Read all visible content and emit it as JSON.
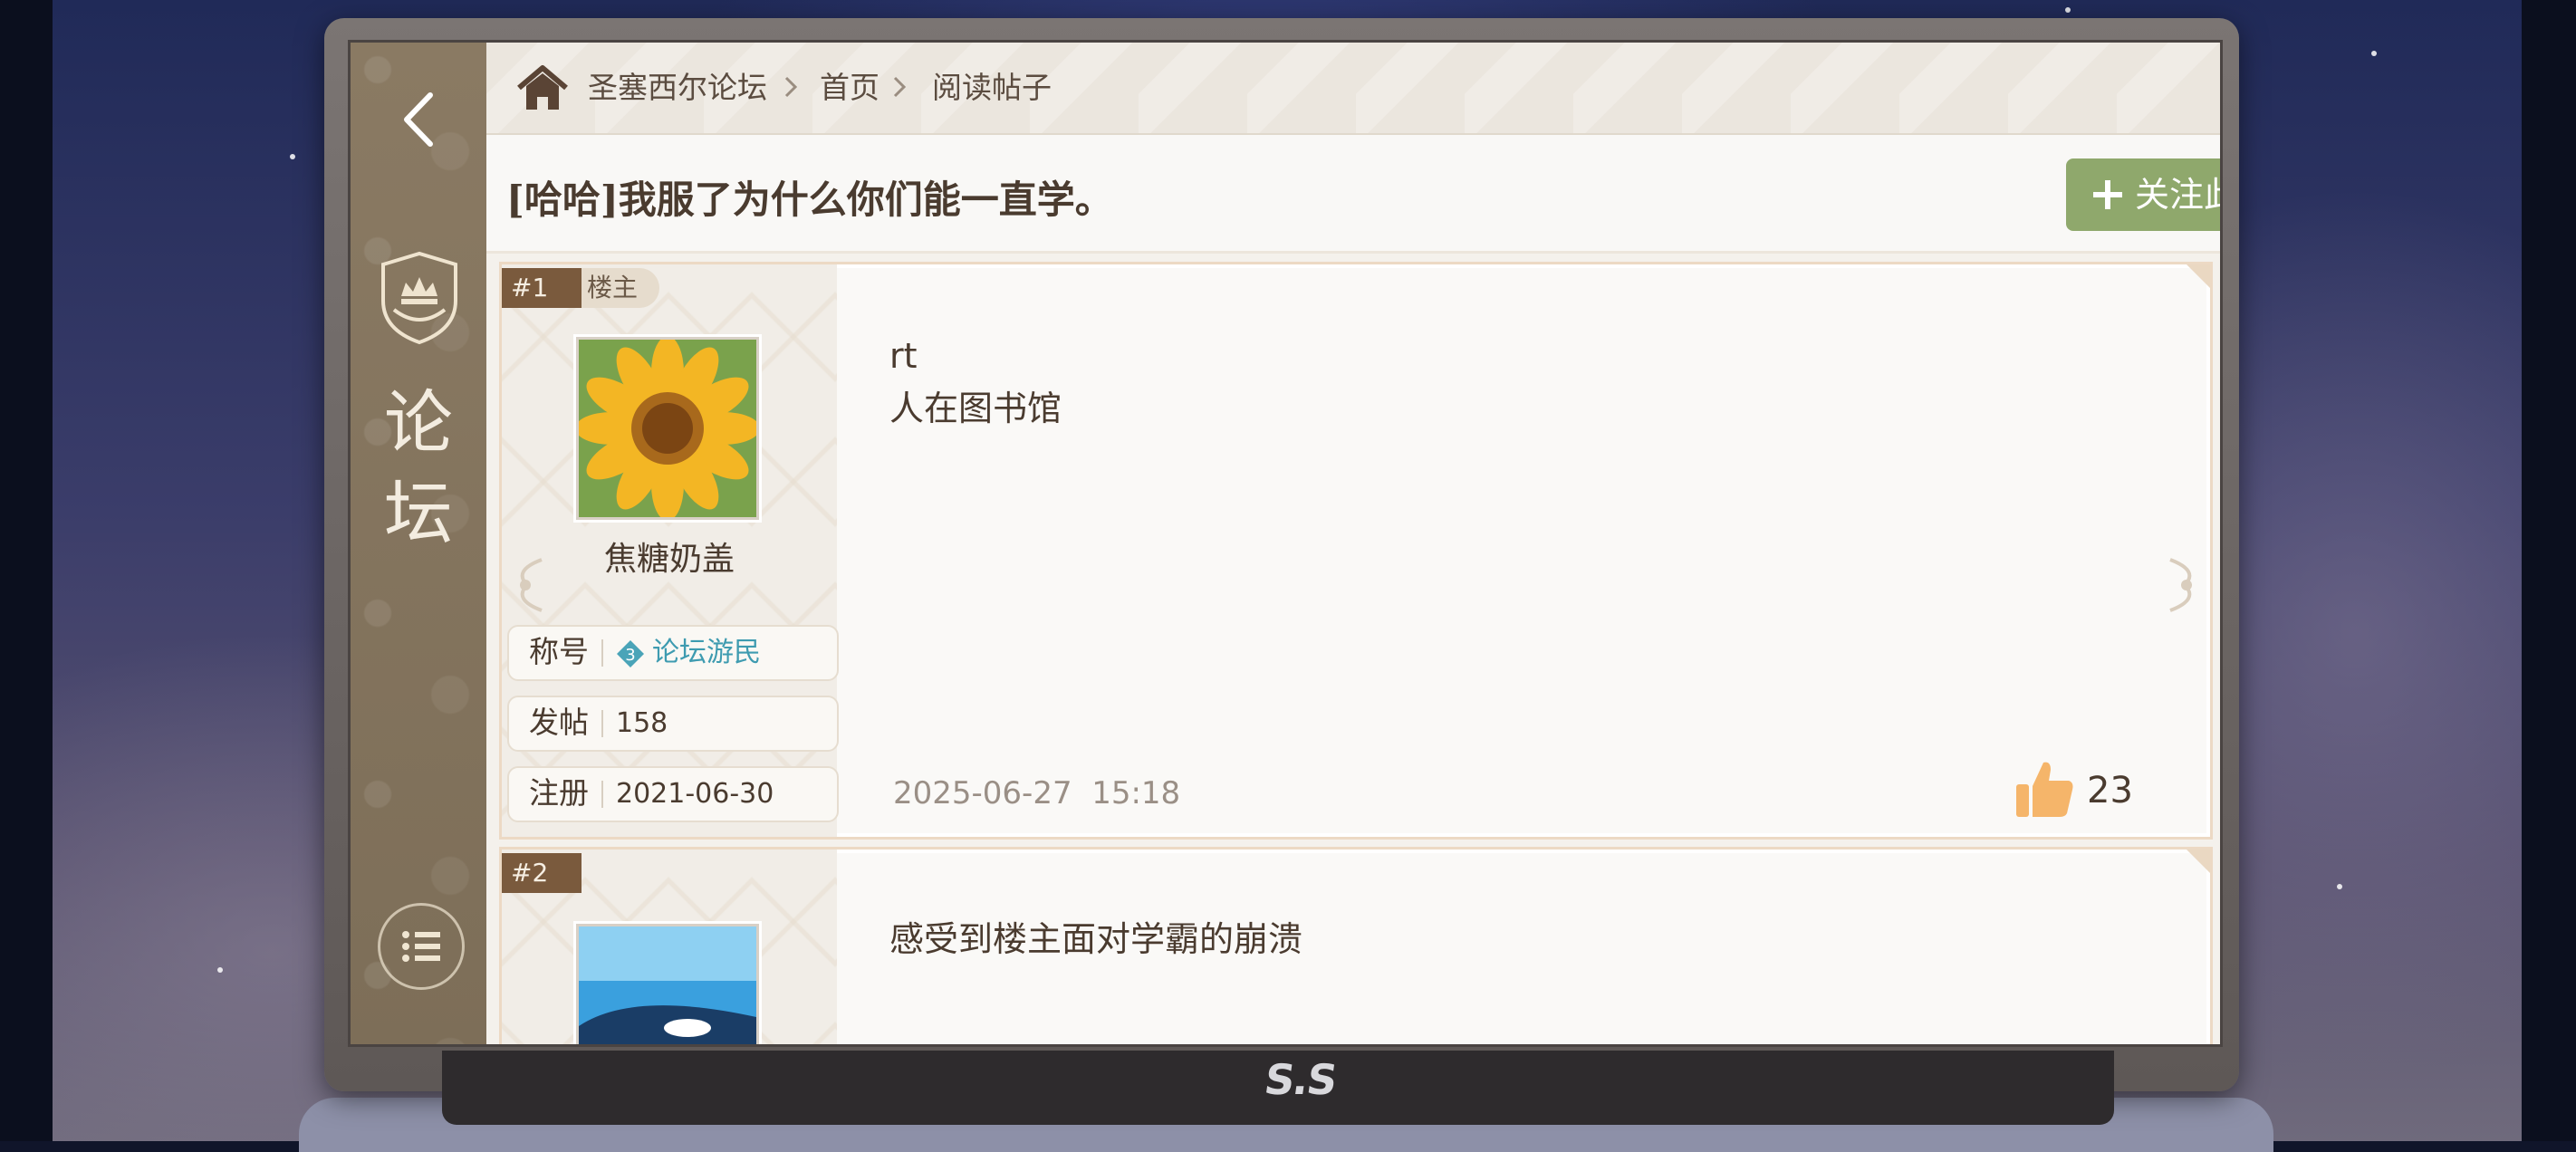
{
  "breadcrumb": {
    "forum": "圣塞西尔论坛",
    "home": "首页",
    "current": "阅读帖子"
  },
  "sidebar": {
    "title_line1": "论",
    "title_line2": "坛"
  },
  "post_title": "[哈哈]我服了为什么你们能一直学。",
  "follow_button": "关注此贴",
  "device_logo": "S.S",
  "posts": [
    {
      "floor": "#1",
      "role": "楼主",
      "username": "焦糖奶盖",
      "avatar": "sunflower",
      "title_label": "称号",
      "title_level": "3",
      "title_value": "论坛游民",
      "posts_label": "发帖",
      "posts_value": "158",
      "register_label": "注册",
      "register_value": "2021-06-30",
      "content_line1": "rt",
      "content_line2": "人在图书馆",
      "timestamp": "2025-06-27  15:18",
      "likes": "23"
    },
    {
      "floor": "#2",
      "avatar": "orca",
      "content_line1": "感受到楼主面对学霸的崩溃"
    }
  ],
  "colors": {
    "accent_green": "#8fa86c",
    "sidebar_brown": "#8a7a63",
    "floor_tag": "#7a5a3d",
    "title_teal": "#3e9bb0",
    "like_orange": "#f5b56a"
  }
}
